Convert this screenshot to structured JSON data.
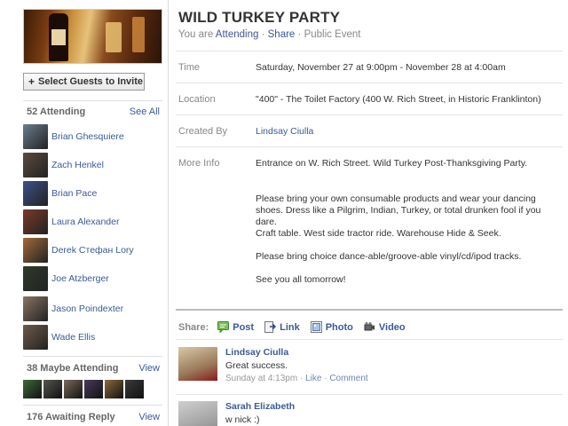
{
  "event": {
    "title": "WILD TURKEY PARTY",
    "subtitle_prefix": "You are ",
    "attending_link": "Attending",
    "sep1": " · ",
    "share_link": "Share",
    "sep2": " · ",
    "privacy": "Public Event"
  },
  "sidebar": {
    "select_guests_label": "Select Guests to Invite",
    "attending": {
      "title": "52 Attending",
      "see_all": "See All",
      "guests": [
        {
          "name": "Brian Ghesquiere",
          "color": "#6a7c8e"
        },
        {
          "name": "Zach Henkel",
          "color": "#5b4a3e"
        },
        {
          "name": "Brian Pace",
          "color": "#3d4f8a"
        },
        {
          "name": "Laura Alexander",
          "color": "#7a3a2a"
        },
        {
          "name": "Derek Стефан Lory",
          "color": "#a26a3a"
        },
        {
          "name": "Joe Atzberger",
          "color": "#2f3a2c"
        },
        {
          "name": "Jason Poindexter",
          "color": "#8a7464"
        },
        {
          "name": "Wade Ellis",
          "color": "#6e5a4a"
        }
      ]
    },
    "maybe": {
      "title": "38 Maybe Attending",
      "view": "View",
      "thumb_colors": [
        "#3f6a3a",
        "#55554f",
        "#7a6a5a",
        "#4a3a5a",
        "#8a6a3a",
        "#3a3a3a"
      ]
    },
    "awaiting": {
      "title": "176 Awaiting Reply",
      "view": "View"
    }
  },
  "details": {
    "time_label": "Time",
    "time_value": "Saturday, November 27 at 9:00pm - November 28 at 4:00am",
    "location_label": "Location",
    "location_value": "\"400\" - The Toilet Factory (400 W. Rich Street, in Historic Franklinton)",
    "created_label": "Created By",
    "created_value": "Lindsay Ciulla",
    "more_label": "More Info",
    "more_paragraphs": [
      "Entrance on W. Rich Street. Wild Turkey Post-Thanksgiving Party.",
      "Please bring your own consumable products and wear your dancing shoes. Dress like a Pilgrim, Indian, Turkey, or total drunken fool if you dare.",
      "Craft table. West side tractor ride. Warehouse Hide & Seek.",
      "Please bring choice dance-able/groove-able vinyl/cd/ipod tracks.",
      "See you all tomorrow!"
    ]
  },
  "share_bar": {
    "label": "Share:",
    "items": [
      "Post",
      "Link",
      "Photo",
      "Video"
    ]
  },
  "comments": [
    {
      "author": "Lindsay Ciulla",
      "text": "Great success.",
      "time": "Sunday at 4:13pm",
      "sep1": " · ",
      "like": "Like",
      "sep2": " · ",
      "comment": "Comment",
      "avatar_color": "#9a7a5a"
    },
    {
      "author": "Sarah Elizabeth",
      "text": "w nick :)",
      "avatar_color": "#8a8a8a"
    }
  ]
}
